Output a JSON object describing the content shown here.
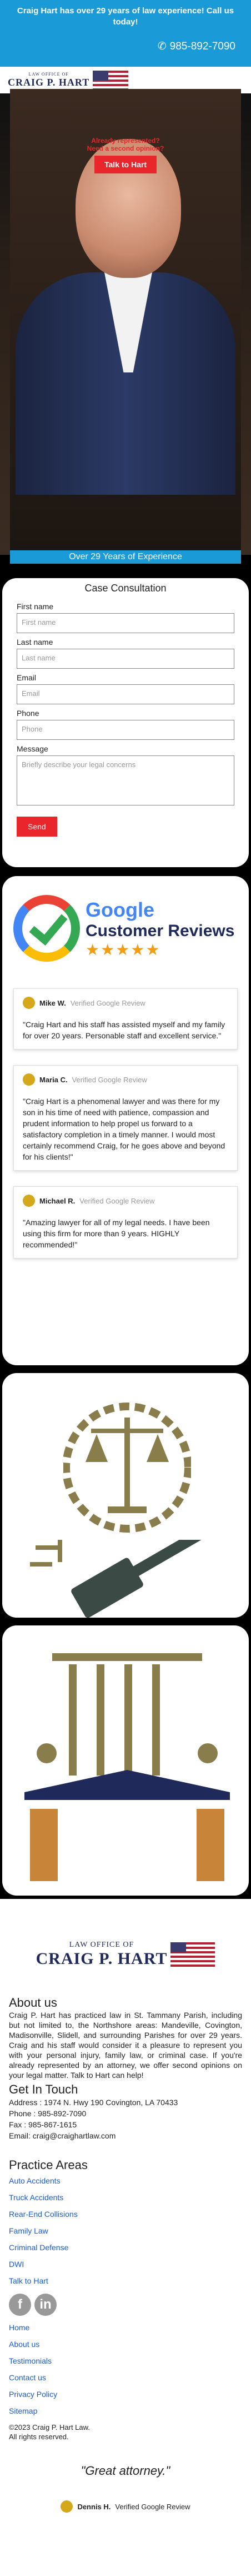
{
  "topbar": {
    "message": "Craig Hart has over 29 years of law experience! Call us today!",
    "phone": "985-892-7090"
  },
  "logo": {
    "line1": "LAW OFFICE OF",
    "line2": "CRAIG P. HART"
  },
  "hero": {
    "question1": "Already represented?",
    "question2": "Need a second opinion?",
    "cta_label": "Talk to Hart",
    "experience": "Over 29 Years of Experience"
  },
  "form": {
    "title": "Case Consultation",
    "fields": [
      {
        "label": "First name",
        "placeholder": "First name"
      },
      {
        "label": "Last name",
        "placeholder": "Last name"
      },
      {
        "label": "Email",
        "placeholder": "Email"
      },
      {
        "label": "Phone",
        "placeholder": "Phone"
      }
    ],
    "message_label": "Message",
    "message_placeholder": "Briefly describe your legal concerns",
    "send_label": "Send"
  },
  "reviews": {
    "google_word": "Google",
    "header_title": "Customer Reviews",
    "stars": "★★★★★",
    "items": [
      {
        "name": "Mike W.",
        "verified": "Verified Google Review",
        "text": "\"Craig Hart and his staff has assisted myself and my family for over 20 years. Personable staff and excellent service.\""
      },
      {
        "name": "Maria C.",
        "verified": "Verified Google Review",
        "text": "\"Craig Hart is a phenomenal lawyer and was there for my son in his time of need with patience, compassion and prudent information to help propel us forward to a satisfactory completion in a timely manner. I would most certainly recommend Craig, for he goes above and beyond for his clients!\""
      },
      {
        "name": "Michael R.",
        "verified": "Verified Google Review",
        "text": "\"Amazing lawyer for all of my legal needs. I have been using this firm for more than 9 years. HIGHLY recommended!\""
      }
    ]
  },
  "footer": {
    "about_title": "About us",
    "about_text": "Craig P. Hart has practiced law in St. Tammany Parish, including but not limited to, the Northshore areas: Mandeville, Covington, Madisonville, Slidell, and surrounding Parishes for over 29 years. Craig and his staff would consider it a pleasure to represent you with your personal injury, family law, or criminal case. If you're already represented by an attorney, we offer second opinions on your legal matter. Talk to Hart can help!",
    "touch_title": "Get In Touch",
    "address": "Address : 1974 N. Hwy 190 Covington, LA 70433",
    "phone": "Phone : 985-892-7090",
    "fax": "Fax : 985-867-1615",
    "email": "Email: craig@craighartlaw.com",
    "practice_title": "Practice Areas",
    "practice_areas": [
      "Auto Accidents",
      "Truck Accidents",
      "Rear-End Collisions",
      "Family Law",
      "Criminal Defense",
      "DWI",
      "Talk to Hart"
    ],
    "nav_links": [
      "Home",
      "About us",
      "Testimonials",
      "Contact us",
      "Privacy Policy",
      "Sitemap"
    ],
    "copyright": "©2023 Craig P. Hart Law.",
    "rights": "All rights reserved.",
    "quote": "\"Great attorney.\"",
    "quote_name": "Dennis H.",
    "quote_verified": "Verified Google Review",
    "social": [
      "f",
      "in"
    ]
  },
  "colors": {
    "brand_blue": "#1a9ad6",
    "cta_red": "#e8262c",
    "navy": "#1f2a5a",
    "olive": "#8a7d4c"
  }
}
